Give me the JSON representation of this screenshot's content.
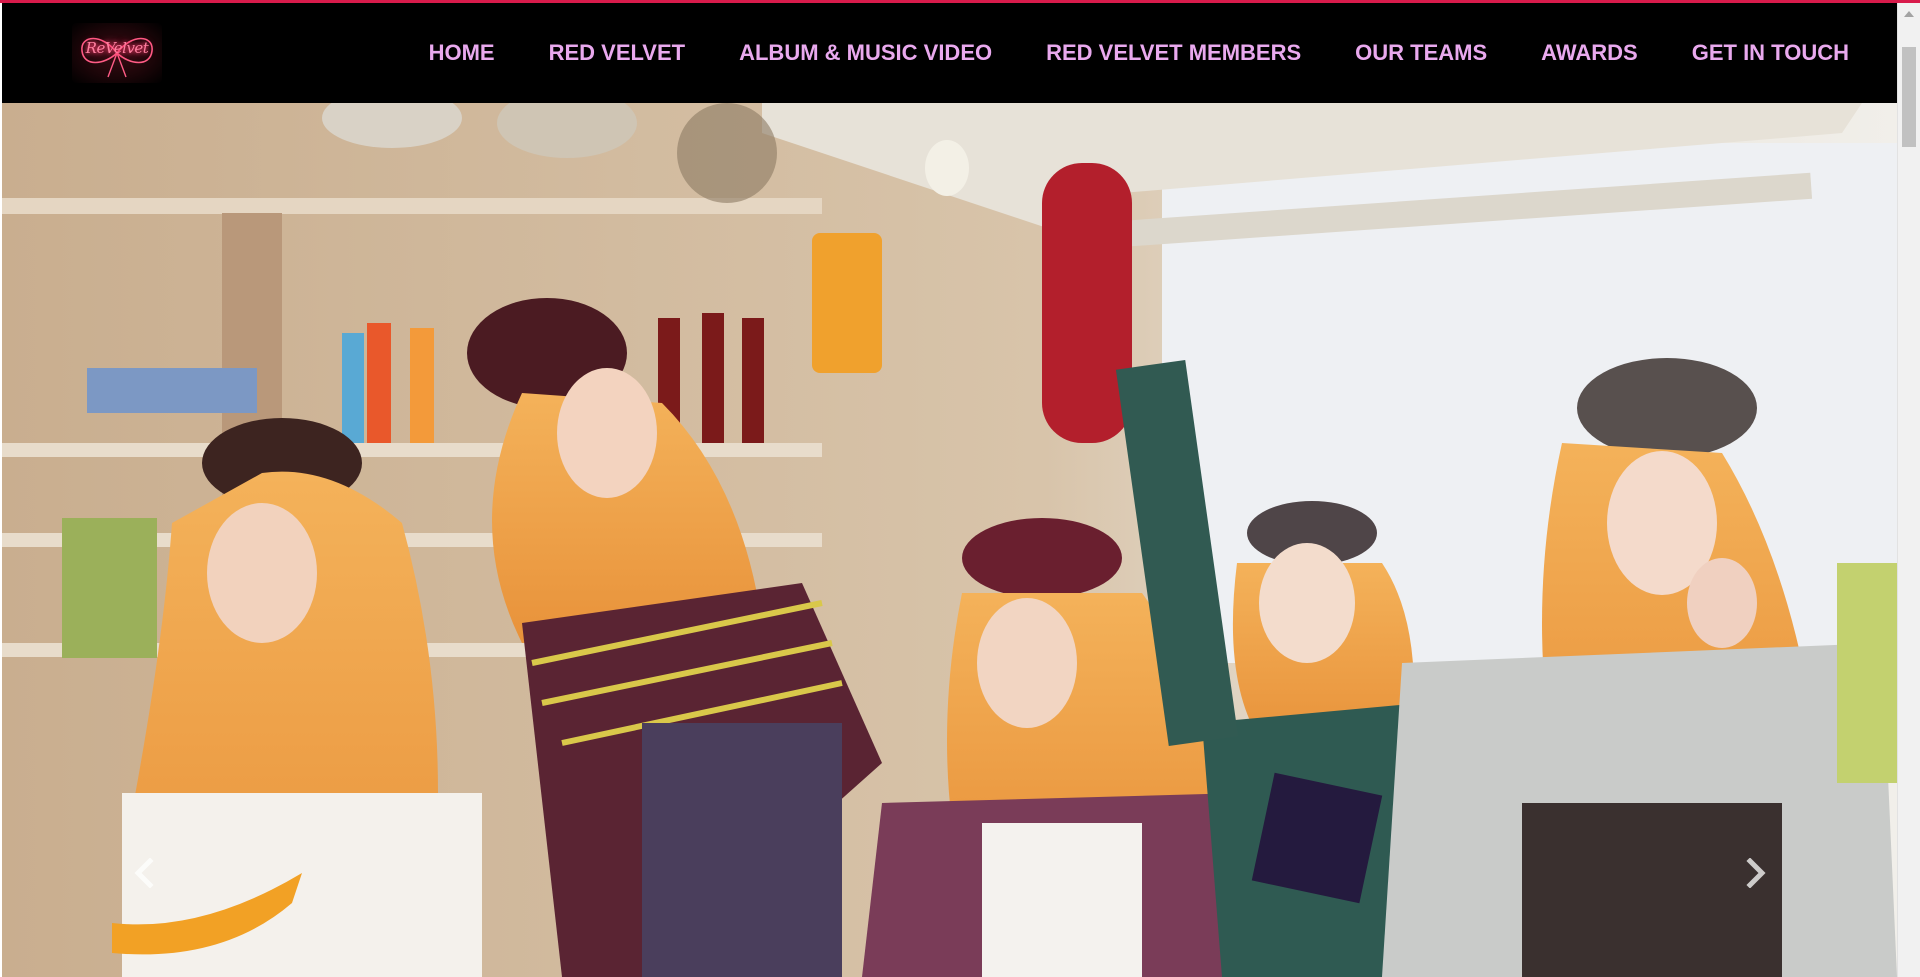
{
  "navbar": {
    "logo_text": "ReVelvet",
    "items": [
      {
        "label": "HOME"
      },
      {
        "label": "RED VELVET"
      },
      {
        "label": "ALBUM & MUSIC VIDEO"
      },
      {
        "label": "RED VELVET MEMBERS"
      },
      {
        "label": "OUR TEAMS"
      },
      {
        "label": "AWARDS"
      },
      {
        "label": "GET IN TOUCH"
      }
    ]
  },
  "hero": {
    "slide_description_icon": "group-photo",
    "prev_icon": "chevron-left-icon",
    "next_icon": "chevron-right-icon"
  },
  "colors": {
    "accent": "#d81b4b",
    "nav_background": "#000000",
    "nav_text": "#e9a9ee",
    "logo_glow": "#ff3d6e"
  }
}
